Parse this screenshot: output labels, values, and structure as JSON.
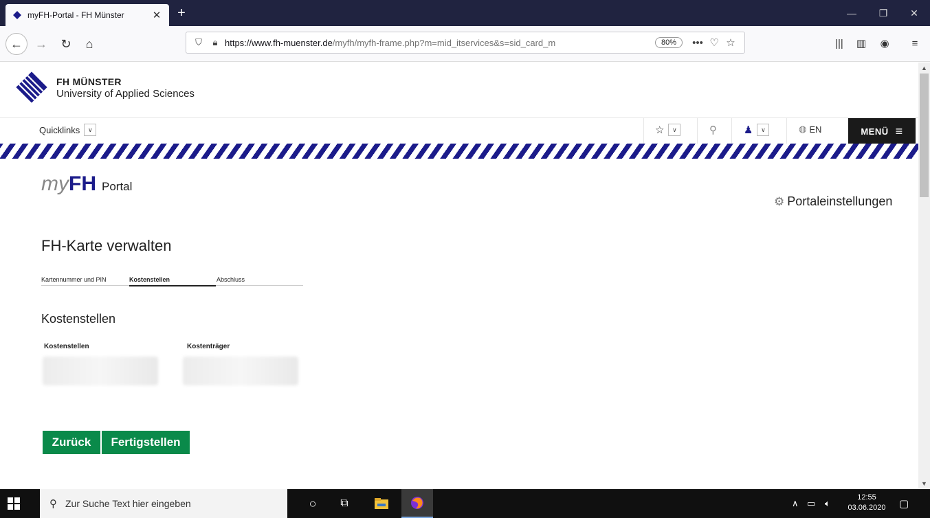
{
  "browser": {
    "tab_title": "myFH-Portal - FH Münster",
    "url_host": "https://www.fh-muenster.de",
    "url_path": "/myfh/myfh-frame.php?m=mid_itservices&s=sid_card_m",
    "zoom": "80%",
    "more_label": "•••"
  },
  "header": {
    "brand_name": "FH MÜNSTER",
    "brand_subtitle": "University of Applied Sciences",
    "quicklinks_label": "Quicklinks",
    "lang_label": "EN",
    "menu_label": "MENÜ"
  },
  "portal": {
    "logo_my": "my",
    "logo_fh": "FH",
    "logo_portal": "Portal",
    "settings_label": "Portaleinstellungen"
  },
  "main": {
    "title": "FH-Karte verwalten",
    "tabs": [
      {
        "label": "Kartennummer und PIN",
        "active": false
      },
      {
        "label": "Kostenstellen",
        "active": true
      },
      {
        "label": "Abschluss",
        "active": false
      }
    ],
    "section_title": "Kostenstellen",
    "table": {
      "headers": [
        "Kostenstellen",
        "Kostenträger"
      ]
    },
    "buttons": {
      "back": "Zurück",
      "finish": "Fertigstellen"
    }
  },
  "taskbar": {
    "search_placeholder": "Zur Suche Text hier eingeben",
    "time": "12:55",
    "date": "03.06.2020"
  },
  "colors": {
    "brand_blue": "#1b1b8a",
    "button_green": "#0a8a4a",
    "titlebar": "#202340"
  }
}
